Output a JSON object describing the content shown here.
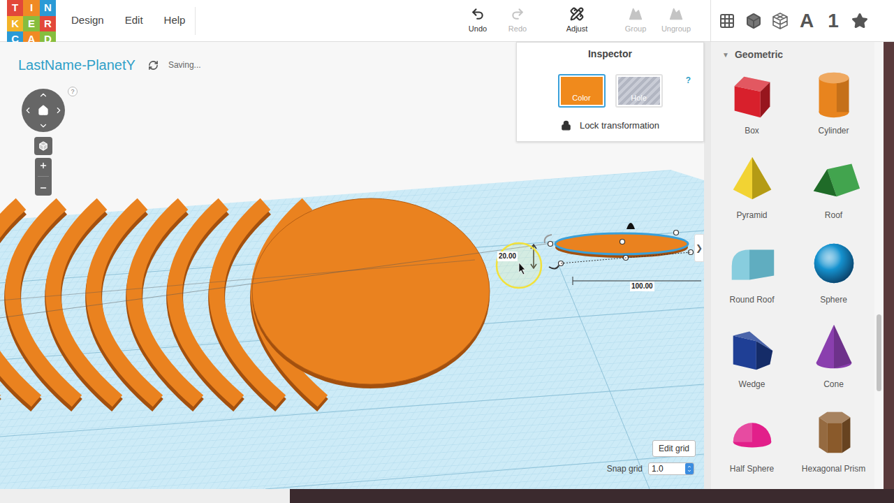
{
  "logo": [
    {
      "letter": "T",
      "color": "#e2483a"
    },
    {
      "letter": "I",
      "color": "#f08a24"
    },
    {
      "letter": "N",
      "color": "#2a9ad6"
    },
    {
      "letter": "K",
      "color": "#f3b328"
    },
    {
      "letter": "E",
      "color": "#86bd3e"
    },
    {
      "letter": "R",
      "color": "#e2483a"
    },
    {
      "letter": "C",
      "color": "#2a9ad6"
    },
    {
      "letter": "A",
      "color": "#f08a24"
    },
    {
      "letter": "D",
      "color": "#86bd3e"
    }
  ],
  "menu": [
    "Design",
    "Edit",
    "Help"
  ],
  "toolbar": [
    {
      "label": "Undo",
      "kind": "undo",
      "disabled": false
    },
    {
      "label": "Redo",
      "kind": "redo",
      "disabled": true
    },
    {
      "label": "Adjust",
      "kind": "adjust",
      "disabled": false
    },
    {
      "label": "Group",
      "kind": "group",
      "disabled": true
    },
    {
      "label": "Ungroup",
      "kind": "ungroup",
      "disabled": true
    }
  ],
  "panel_tabs": [
    {
      "kind": "grid",
      "label": ""
    },
    {
      "kind": "box",
      "label": ""
    },
    {
      "kind": "wire",
      "label": ""
    },
    {
      "kind": "text",
      "label": "A"
    },
    {
      "kind": "text",
      "label": "1"
    },
    {
      "kind": "star",
      "label": ""
    }
  ],
  "project": {
    "title": "LastName-PlanetY",
    "status": "Saving..."
  },
  "view_help": "?",
  "inspector": {
    "title": "Inspector",
    "buttons": [
      {
        "label": "Color",
        "kind": "color",
        "selected": true
      },
      {
        "label": "Hole",
        "kind": "hole",
        "selected": false
      }
    ],
    "help": "?",
    "lock_label": "Lock transformation"
  },
  "canvas": {
    "height_label": "20.00",
    "length_label": "100.00",
    "toggle": "❯"
  },
  "grid_controls": {
    "edit_grid": "Edit grid",
    "snap_label": "Snap grid",
    "snap_value": "1.0"
  },
  "library": {
    "section": "Geometric",
    "arrow": "▼",
    "shapes": [
      {
        "label": "Box",
        "kind": "box",
        "color": "#d8202c"
      },
      {
        "label": "Cylinder",
        "kind": "cylinder",
        "color": "#e8841e"
      },
      {
        "label": "Pyramid",
        "kind": "pyramid",
        "color": "#f1cf1c"
      },
      {
        "label": "Roof",
        "kind": "roof",
        "color": "#2d9a3a"
      },
      {
        "label": "Round Roof",
        "kind": "roundroof",
        "color": "#6bc1d6"
      },
      {
        "label": "Sphere",
        "kind": "sphere",
        "color": "#1592cf"
      },
      {
        "label": "Wedge",
        "kind": "wedge",
        "color": "#1f3f95"
      },
      {
        "label": "Cone",
        "kind": "cone",
        "color": "#8a3fae"
      },
      {
        "label": "Half Sphere",
        "kind": "halfsphere",
        "color": "#e21f8a"
      },
      {
        "label": "Hexagonal Prism",
        "kind": "hexprism",
        "color": "#8a5a2b"
      }
    ]
  }
}
